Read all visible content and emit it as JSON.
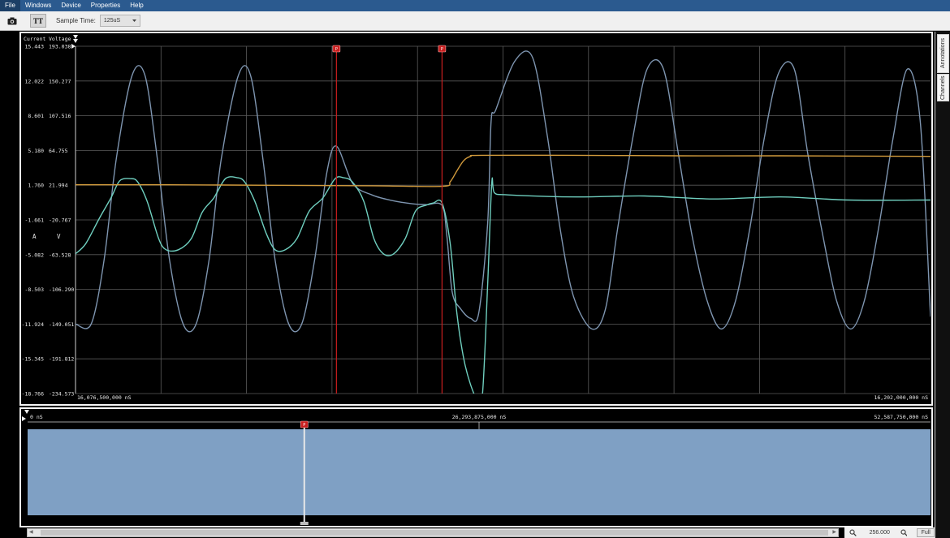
{
  "menu": {
    "file": "File",
    "windows": "Windows",
    "device": "Device",
    "properties": "Properties",
    "help": "Help"
  },
  "toolbar": {
    "camera_icon": "camera-icon",
    "text_icon": "text-size-icon",
    "text_glyph": "TT",
    "sample_time_label": "Sample Time:",
    "sample_time_value": "125uS"
  },
  "side_tabs": {
    "annotations": "Annotations",
    "channels": "Channels"
  },
  "colors": {
    "voltage_trace": "#7e95b0",
    "current_trace": "#6fcfbf",
    "orange_trace": "#d19a3c",
    "marker": "#c81e1e",
    "overview_fill": "#7fa0c4"
  },
  "chart_data": [
    {
      "type": "line",
      "y_left_label": "Current",
      "y_right_label": "Voltage",
      "y_left_unit": "A",
      "y_right_unit": "V",
      "current_ticks": [
        "15.443",
        "12.022",
        "8.601",
        "5.180",
        "1.760",
        "-1.661",
        "-5.082",
        "-8.503",
        "-11.924",
        "-15.345",
        "-18.766"
      ],
      "voltage_ticks": [
        "193.038",
        "150.277",
        "107.516",
        "64.755",
        "21.994",
        "-20.767",
        "-63.528",
        "-106.290",
        "-149.051",
        "-191.812",
        "-234.573"
      ],
      "current_range": [
        -18.766,
        15.443
      ],
      "voltage_range": [
        -234.573,
        193.038
      ],
      "x_start_label": "16,076,500,000 nS",
      "x_end_label": "16,202,000,000 nS",
      "x_range_ns": [
        16076500000,
        16202000000
      ],
      "markers": [
        {
          "label": "P",
          "x_ns": 16114800000
        },
        {
          "label": "P",
          "x_ns": 16130300000
        }
      ],
      "grid": true,
      "series": [
        {
          "trace": "voltage",
          "points": [
            [
              16076500000,
              -149
            ],
            [
              16078800000,
              -149
            ],
            [
              16080700000,
              -70
            ],
            [
              16082500000,
              55
            ],
            [
              16084800000,
              157
            ],
            [
              16086700000,
              157
            ],
            [
              16088500000,
              55
            ],
            [
              16090300000,
              -70
            ],
            [
              16092300000,
              -149
            ],
            [
              16094200000,
              -149
            ],
            [
              16096100000,
              -70
            ],
            [
              16097900000,
              55
            ],
            [
              16100400000,
              157
            ],
            [
              16102200000,
              157
            ],
            [
              16104000000,
              55
            ],
            [
              16105800000,
              -70
            ],
            [
              16107800000,
              -149
            ],
            [
              16109700000,
              -149
            ],
            [
              16111600000,
              -70
            ],
            [
              16113400000,
              38
            ],
            [
              16114800000,
              70
            ],
            [
              16117200000,
              24
            ],
            [
              16120000000,
              10
            ],
            [
              16123000000,
              3
            ],
            [
              16126000000,
              -1
            ],
            [
              16128000000,
              -2
            ],
            [
              16130300000,
              -3
            ],
            [
              16131000000,
              -40
            ],
            [
              16131800000,
              -110
            ],
            [
              16133000000,
              -130
            ],
            [
              16134500000,
              -142
            ],
            [
              16135700000,
              -135
            ],
            [
              16137000000,
              -25
            ],
            [
              16137500000,
              100
            ],
            [
              16138200000,
              115
            ],
            [
              16141000000,
              175
            ],
            [
              16143600000,
              179
            ],
            [
              16145800000,
              80
            ],
            [
              16147600000,
              -30
            ],
            [
              16149600000,
              -115
            ],
            [
              16152300000,
              -155
            ],
            [
              16154300000,
              -130
            ],
            [
              16156100000,
              -30
            ],
            [
              16158300000,
              80
            ],
            [
              16160400000,
              165
            ],
            [
              16162800000,
              165
            ],
            [
              16165000000,
              60
            ],
            [
              16167000000,
              -40
            ],
            [
              16169200000,
              -120
            ],
            [
              16171300000,
              -155
            ],
            [
              16173400000,
              -120
            ],
            [
              16175500000,
              -30
            ],
            [
              16177600000,
              80
            ],
            [
              16179700000,
              160
            ],
            [
              16182000000,
              165
            ],
            [
              16184000000,
              60
            ],
            [
              16186200000,
              -40
            ],
            [
              16188200000,
              -120
            ],
            [
              16190300000,
              -155
            ],
            [
              16192300000,
              -120
            ],
            [
              16194400000,
              -30
            ],
            [
              16196500000,
              80
            ],
            [
              16198600000,
              165
            ],
            [
              16200500000,
              100
            ],
            [
              16202000000,
              -140
            ]
          ]
        },
        {
          "trace": "current",
          "points": [
            [
              16076500000,
              -5
            ],
            [
              16078000000,
              -4
            ],
            [
              16080000000,
              -1.5
            ],
            [
              16081700000,
              0.5
            ],
            [
              16083000000,
              2.2
            ],
            [
              16084600000,
              2.4
            ],
            [
              16085600000,
              2.1
            ],
            [
              16087000000,
              0.2
            ],
            [
              16088700000,
              -3.5
            ],
            [
              16089800000,
              -4.6
            ],
            [
              16091600000,
              -4.6
            ],
            [
              16093500000,
              -3.5
            ],
            [
              16095100000,
              -0.9
            ],
            [
              16096800000,
              0.5
            ],
            [
              16098500000,
              2.4
            ],
            [
              16100200000,
              2.5
            ],
            [
              16101300000,
              2.1
            ],
            [
              16102800000,
              0.2
            ],
            [
              16104500000,
              -3
            ],
            [
              16105800000,
              -4.6
            ],
            [
              16107300000,
              -4.6
            ],
            [
              16109000000,
              -3.5
            ],
            [
              16110800000,
              -0.8
            ],
            [
              16112800000,
              0.5
            ],
            [
              16114600000,
              2.4
            ],
            [
              16115800000,
              2.5
            ],
            [
              16117100000,
              2.1
            ],
            [
              16118800000,
              0.2
            ],
            [
              16120300000,
              -3.5
            ],
            [
              16121700000,
              -5
            ],
            [
              16123200000,
              -5
            ],
            [
              16124900000,
              -3.5
            ],
            [
              16126400000,
              -0.8
            ],
            [
              16128000000,
              -0.2
            ],
            [
              16129000000,
              0
            ],
            [
              16130300000,
              0
            ],
            [
              16131500000,
              -4
            ],
            [
              16132500000,
              -11
            ],
            [
              16133700000,
              -16
            ],
            [
              16135200000,
              -20
            ],
            [
              16136200000,
              -20
            ],
            [
              16137000000,
              -8
            ],
            [
              16137600000,
              2
            ],
            [
              16138000000,
              1
            ],
            [
              16140000000,
              0.8
            ],
            [
              16150000000,
              0.6
            ],
            [
              16160000000,
              0.7
            ],
            [
              16170000000,
              0.4
            ],
            [
              16180000000,
              0.6
            ],
            [
              16190000000,
              0.3
            ],
            [
              16202000000,
              0.3
            ]
          ]
        },
        {
          "trace": "orange",
          "points": [
            [
              16076500000,
              1.8
            ],
            [
              16090000000,
              1.8
            ],
            [
              16105000000,
              1.75
            ],
            [
              16120000000,
              1.7
            ],
            [
              16130300000,
              1.65
            ],
            [
              16131500000,
              2.1
            ],
            [
              16132500000,
              3.2
            ],
            [
              16133500000,
              4.2
            ],
            [
              16134500000,
              4.6
            ],
            [
              16136000000,
              4.7
            ],
            [
              16150000000,
              4.7
            ],
            [
              16165000000,
              4.65
            ],
            [
              16180000000,
              4.65
            ],
            [
              16202000000,
              4.6
            ]
          ]
        }
      ]
    },
    {
      "type": "area",
      "x_start_label": "0 nS",
      "x_mid_label": "26,293,875,000 nS",
      "x_end_label": "52,587,750,000 nS",
      "x_range_ns": [
        0,
        52587750000
      ],
      "cursor": {
        "label": "P",
        "x_ns": 16114800000
      }
    }
  ],
  "bottom": {
    "zoom_in_icon": "zoom-in-icon",
    "zoom_value": "256.000",
    "zoom_out_icon": "zoom-out-icon",
    "full_label": "Full"
  }
}
